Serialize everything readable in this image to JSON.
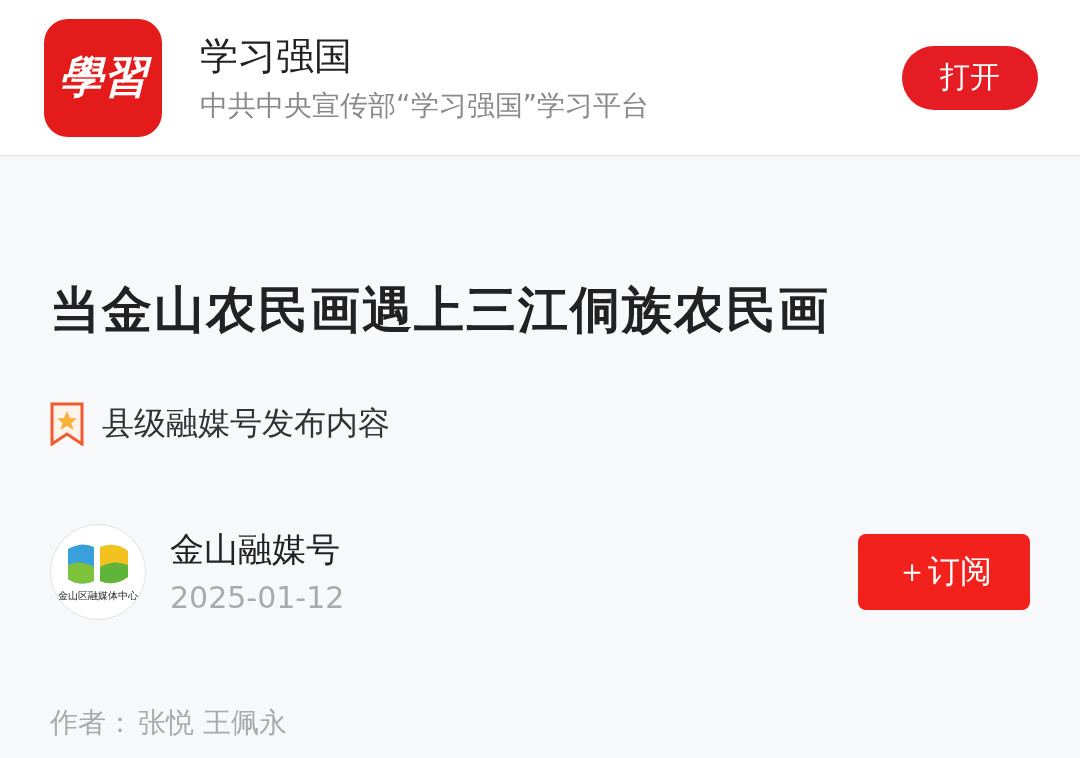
{
  "app_banner": {
    "icon_text": "學習",
    "name": "学习强国",
    "subtitle": "中共中央宣传部“学习强国”学习平台",
    "open_button": "打开"
  },
  "article": {
    "title": "当金山农民画遇上三江侗族农民画",
    "badge": "县级融媒号发布内容",
    "publisher": {
      "logo_text": "金山区融媒体中心",
      "name": "金山融媒号",
      "date": "2025-01-12",
      "subscribe_button": "＋订阅"
    },
    "author_label": "作者：",
    "authors": "张悦 王佩永"
  }
}
